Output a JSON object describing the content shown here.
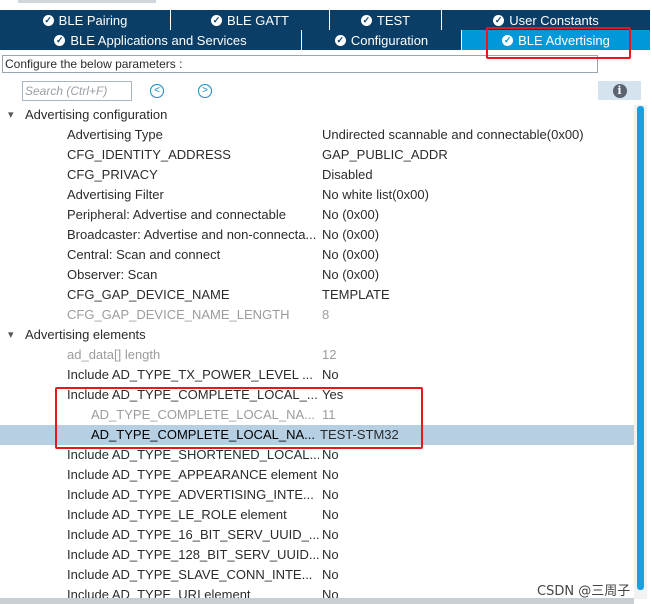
{
  "tabs_row1": [
    {
      "label": "BLE Pairing"
    },
    {
      "label": "BLE GATT"
    },
    {
      "label": "TEST"
    },
    {
      "label": "User Constants"
    }
  ],
  "tabs_row2": [
    {
      "label": "BLE Applications and Services"
    },
    {
      "label": "Configuration"
    },
    {
      "label": "BLE Advertising",
      "active": true
    }
  ],
  "description": "Configure the below parameters :",
  "search": {
    "placeholder": "Search (Ctrl+F)"
  },
  "icons": {
    "tab_check": "check-circle-icon",
    "prev": "chevron-left-circle-icon",
    "next": "chevron-right-circle-icon",
    "info": "info-icon",
    "expand": "chevron-down-icon"
  },
  "colors": {
    "tab_bg": "#0b3e66",
    "tab_active": "#0098d8",
    "selection": "#b6cfe3",
    "highlight": "#e8161d",
    "scrollbar": "#1aa0e0"
  },
  "tree": [
    {
      "label": "Advertising configuration",
      "category": true
    },
    {
      "label": "Advertising Type",
      "value": "Undirected scannable and connectable(0x00)"
    },
    {
      "label": "CFG_IDENTITY_ADDRESS",
      "value": "GAP_PUBLIC_ADDR"
    },
    {
      "label": "CFG_PRIVACY",
      "value": "Disabled"
    },
    {
      "label": "Advertising Filter",
      "value": "No white list(0x00)"
    },
    {
      "label": "Peripheral: Advertise and connectable",
      "value": "No (0x00)"
    },
    {
      "label": "Broadcaster: Advertise and non-connecta...",
      "value": "No (0x00)"
    },
    {
      "label": "Central: Scan and connect",
      "value": "No (0x00)"
    },
    {
      "label": "Observer: Scan",
      "value": "No (0x00)"
    },
    {
      "label": "CFG_GAP_DEVICE_NAME",
      "value": "TEMPLATE"
    },
    {
      "label": "CFG_GAP_DEVICE_NAME_LENGTH",
      "value": "8",
      "disabled": true
    },
    {
      "label": "Advertising elements",
      "category": true
    },
    {
      "label": "ad_data[] length",
      "value": "12",
      "disabled": true
    },
    {
      "label": "Include AD_TYPE_TX_POWER_LEVEL ...",
      "value": "No"
    },
    {
      "label": "Include AD_TYPE_COMPLETE_LOCAL_...",
      "value": "Yes"
    },
    {
      "label": "AD_TYPE_COMPLETE_LOCAL_NA...",
      "value": "11",
      "disabled": true,
      "sub": true
    },
    {
      "label": "AD_TYPE_COMPLETE_LOCAL_NA...",
      "value": "TEST-STM32",
      "sub": true,
      "selected": true
    },
    {
      "label": "Include AD_TYPE_SHORTENED_LOCAL...",
      "value": "No"
    },
    {
      "label": "Include AD_TYPE_APPEARANCE element",
      "value": "No"
    },
    {
      "label": "Include AD_TYPE_ADVERTISING_INTE...",
      "value": "No"
    },
    {
      "label": "Include AD_TYPE_LE_ROLE element",
      "value": "No"
    },
    {
      "label": "Include AD_TYPE_16_BIT_SERV_UUID_...",
      "value": "No"
    },
    {
      "label": "Include AD_TYPE_128_BIT_SERV_UUID...",
      "value": "No"
    },
    {
      "label": "Include AD_TYPE_SLAVE_CONN_INTE...",
      "value": "No"
    },
    {
      "label": "Include AD_TYPE_URI element",
      "value": "No"
    }
  ],
  "watermark": "CSDN @三周子"
}
